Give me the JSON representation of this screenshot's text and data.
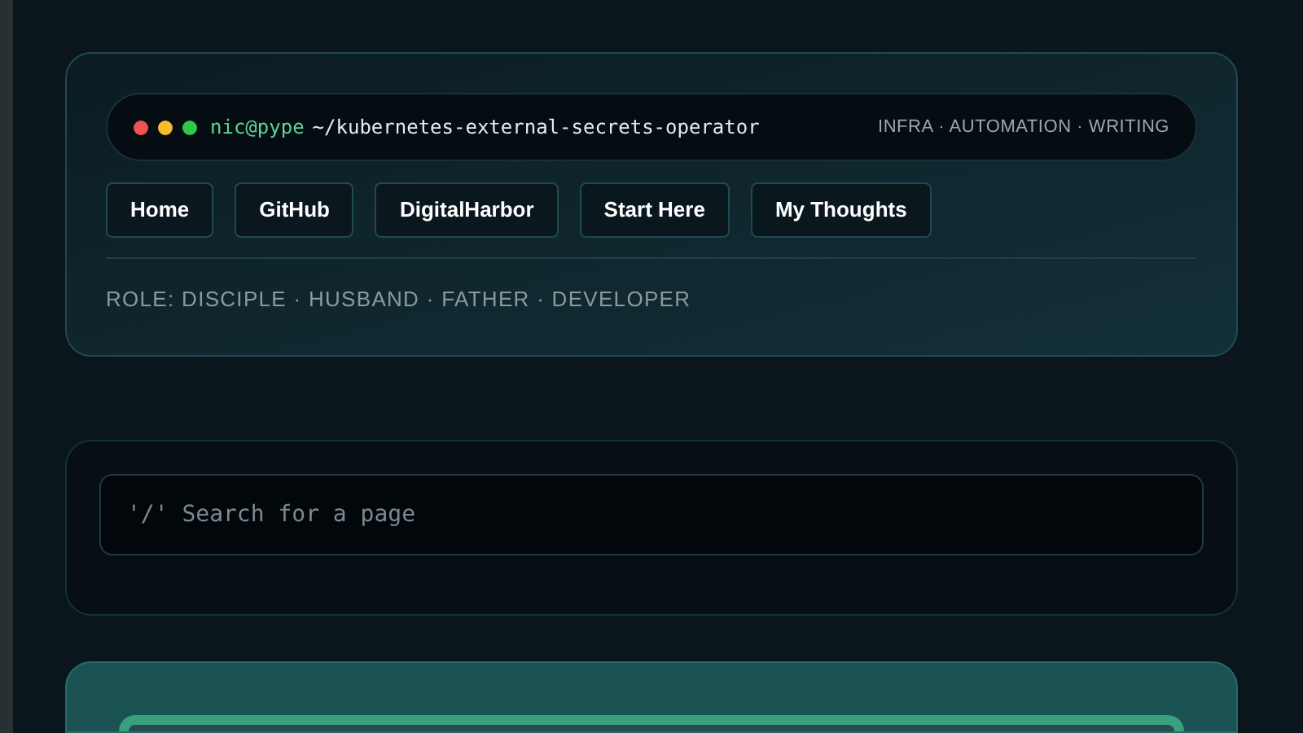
{
  "header": {
    "prompt_user": "nic@pype",
    "path": "~/kubernetes-external-secrets-operator",
    "tagline": "INFRA · AUTOMATION · WRITING",
    "nav": [
      "Home",
      "GitHub",
      "DigitalHarbor",
      "Start Here",
      "My Thoughts"
    ],
    "role": "ROLE: DISCIPLE · HUSBAND · FATHER · DEVELOPER"
  },
  "search": {
    "placeholder": "'/' Search for a page"
  }
}
